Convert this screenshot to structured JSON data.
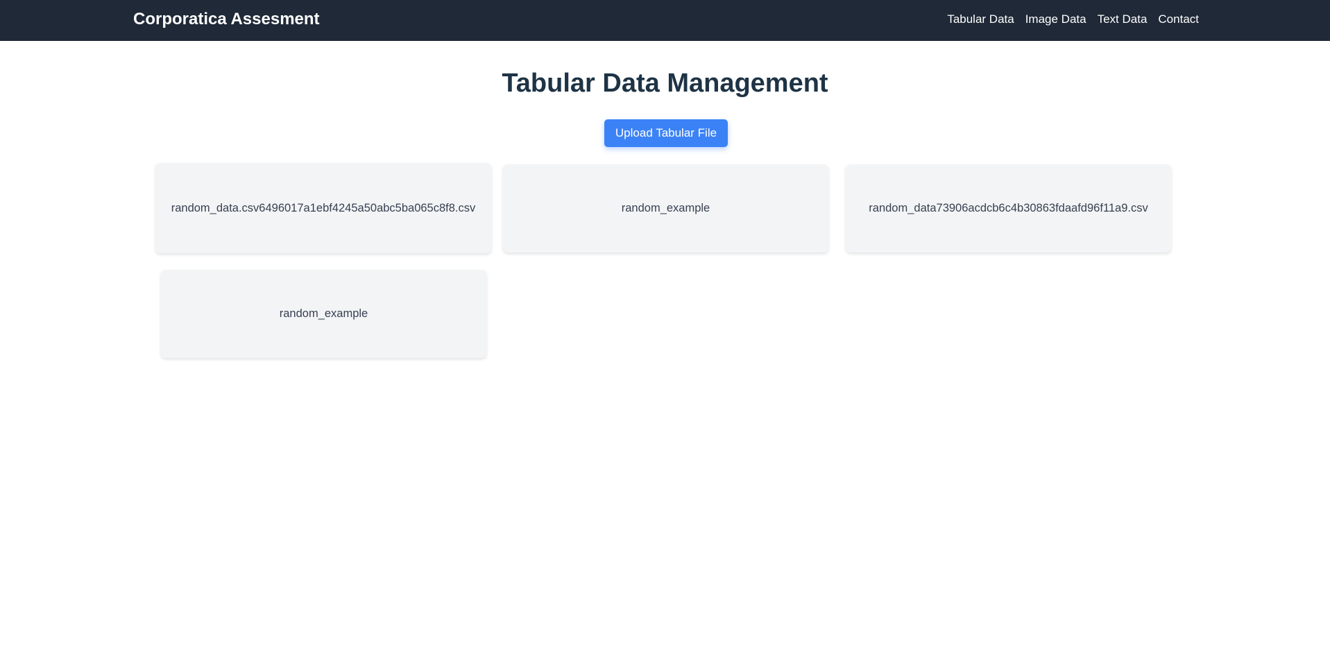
{
  "navbar": {
    "brand": "Corporatica Assesment",
    "links": [
      {
        "label": "Tabular Data"
      },
      {
        "label": "Image Data"
      },
      {
        "label": "Text Data"
      },
      {
        "label": "Contact"
      }
    ]
  },
  "main": {
    "title": "Tabular Data Management",
    "upload_label": "Upload Tabular File",
    "files": [
      {
        "name": "random_data.csv6496017a1ebf4245a50abc5ba065c8f8.csv"
      },
      {
        "name": "random_example"
      },
      {
        "name": "random_data73906acdcb6c4b30863fdaafd96f11a9.csv"
      },
      {
        "name": "random_example"
      }
    ]
  },
  "colors": {
    "navbar_bg": "#1f2937",
    "accent": "#3b82f6",
    "card_bg": "#f3f4f6",
    "title": "#1e3345"
  }
}
